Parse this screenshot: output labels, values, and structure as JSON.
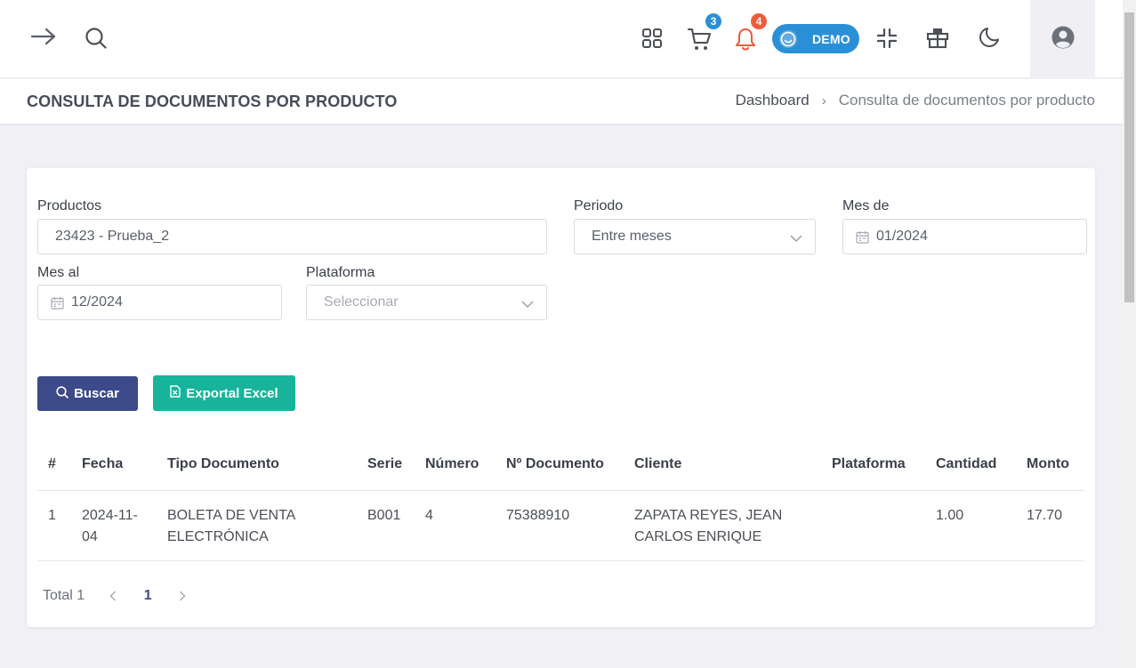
{
  "topbar": {
    "cart_badge": "3",
    "notifications_badge": "4",
    "demo_label": "DEMO",
    "colors": {
      "cart_badge": "#2b8fd8",
      "notif_badge": "#ef5b3c",
      "notif_icon": "#ef5b3c",
      "demo_pill": "#2b8fd8"
    }
  },
  "header": {
    "title": "CONSULTA DE DOCUMENTOS POR PRODUCTO",
    "breadcrumb": {
      "home": "Dashboard",
      "separator": "›",
      "current": "Consulta de documentos por producto"
    }
  },
  "form": {
    "productos": {
      "label": "Productos",
      "value": "23423 - Prueba_2"
    },
    "periodo": {
      "label": "Periodo",
      "value": "Entre meses"
    },
    "mes_de": {
      "label": "Mes de",
      "value": "01/2024"
    },
    "mes_al": {
      "label": "Mes al",
      "value": "12/2024"
    },
    "plataforma": {
      "label": "Plataforma",
      "placeholder": "Seleccionar"
    }
  },
  "buttons": {
    "search": "Buscar",
    "export": "Exportal Excel",
    "colors": {
      "search": "#3c4a8a",
      "export": "#17b49b"
    }
  },
  "table": {
    "headers": [
      "#",
      "Fecha",
      "Tipo Documento",
      "Serie",
      "Número",
      "Nº Documento",
      "Cliente",
      "Plataforma",
      "Cantidad",
      "Monto"
    ],
    "rows": [
      {
        "num": "1",
        "fecha_l1": "2024-11-",
        "fecha_l2": "04",
        "tipo_l1": "BOLETA DE VENTA",
        "tipo_l2": "ELECTRÓNICA",
        "serie": "B001",
        "numero": "4",
        "documento": "75388910",
        "cliente_l1": "ZAPATA REYES, JEAN",
        "cliente_l2": "CARLOS ENRIQUE",
        "plataforma": "",
        "cantidad": "1.00",
        "monto": "17.70"
      }
    ]
  },
  "pagination": {
    "total": "Total 1",
    "current_page": "1"
  }
}
